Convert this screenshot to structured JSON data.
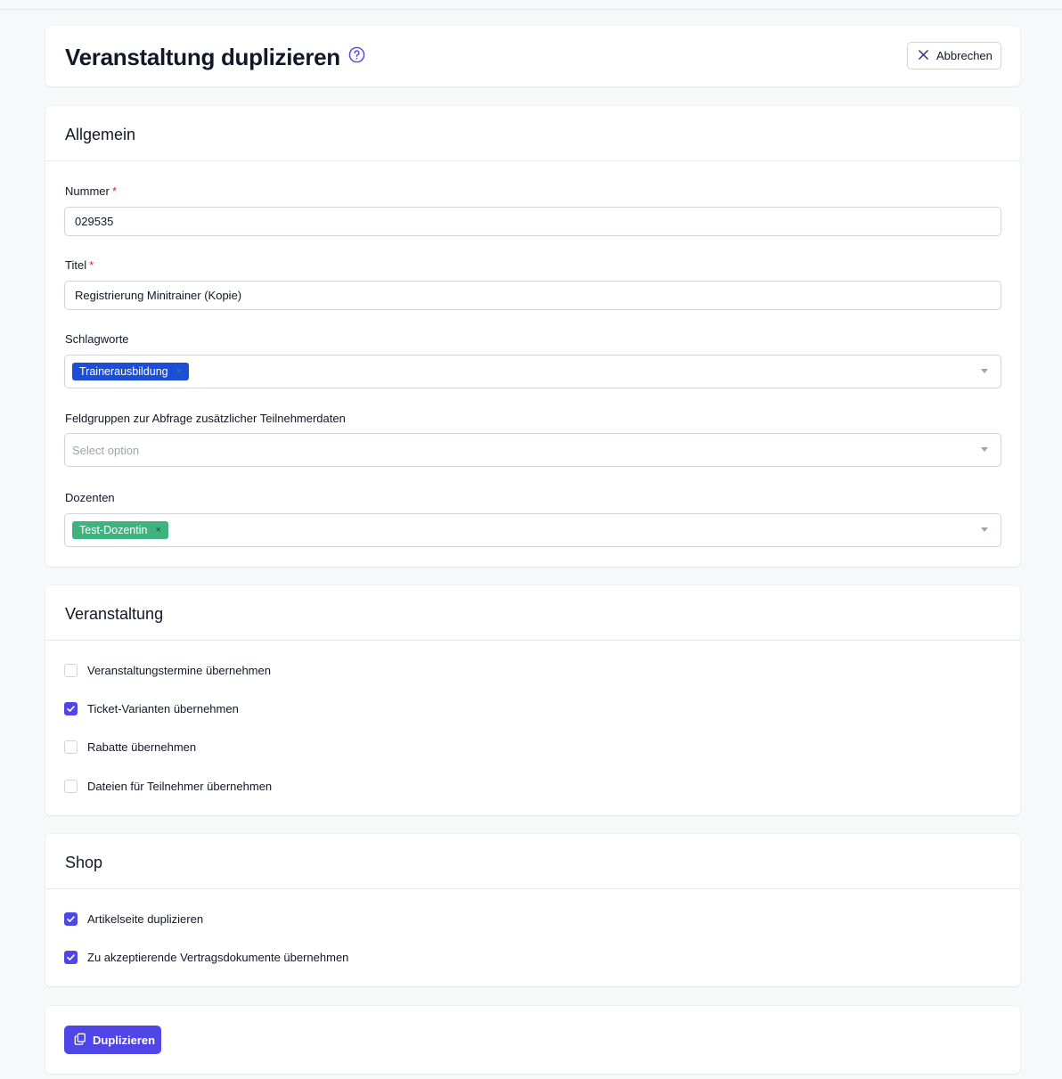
{
  "header": {
    "title": "Veranstaltung duplizieren",
    "cancel_label": "Abbrechen"
  },
  "general": {
    "section_title": "Allgemein",
    "number": {
      "label": "Nummer",
      "required_mark": "*",
      "value": "029535"
    },
    "title": {
      "label": "Titel",
      "required_mark": "*",
      "value": "Registrierung Minitrainer (Kopie)"
    },
    "tags": {
      "label": "Schlagworte",
      "selected": "Trainerausbildung",
      "remove": "×"
    },
    "field_groups": {
      "label": "Feldgruppen zur Abfrage zusätzlicher Teilnehmerdaten",
      "placeholder": "Select option"
    },
    "lecturers": {
      "label": "Dozenten",
      "selected": "Test-Dozentin",
      "remove": "×"
    }
  },
  "event": {
    "section_title": "Veranstaltung",
    "options": [
      {
        "label": "Veranstaltungstermine übernehmen",
        "checked": false
      },
      {
        "label": "Ticket-Varianten übernehmen",
        "checked": true
      },
      {
        "label": "Rabatte übernehmen",
        "checked": false
      },
      {
        "label": "Dateien für Teilnehmer übernehmen",
        "checked": false
      }
    ]
  },
  "shop": {
    "section_title": "Shop",
    "options": [
      {
        "label": "Artikelseite duplizieren",
        "checked": true
      },
      {
        "label": "Zu akzeptierende Vertragsdokumente übernehmen",
        "checked": true
      }
    ]
  },
  "actions": {
    "duplicate_label": "Duplizieren"
  },
  "colors": {
    "accent": "#4f46e5",
    "tag_blue": "#1d4ed8",
    "tag_green": "#3fb37f",
    "required": "#dc2626"
  }
}
